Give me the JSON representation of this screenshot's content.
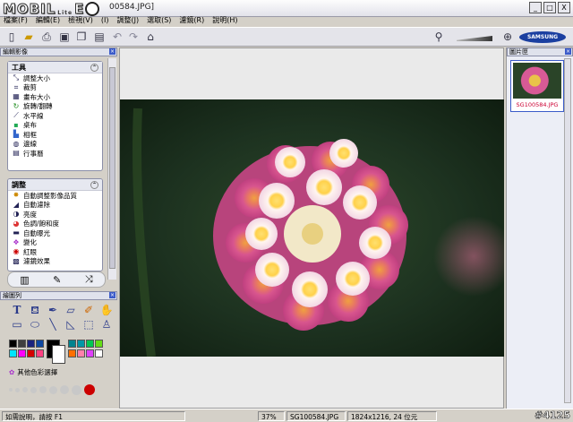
{
  "app": {
    "title_suffix": "00584.JPG]",
    "logo_left": "MOBIL",
    "logo_version": "Lite",
    "logo_right": "E"
  },
  "window_buttons": [
    "_",
    "□",
    "X"
  ],
  "menu": [
    "檔案(F)",
    "編輯(E)",
    "檢視(V)",
    "(I)",
    "調整(J)",
    "選取(S)",
    "濾鏡(R)",
    "說明(H)"
  ],
  "toolbar": {
    "icons": [
      "new-icon",
      "open-icon",
      "print-icon",
      "save-icon",
      "copy-icon",
      "paste-icon",
      "undo-icon",
      "redo-icon",
      "home-icon"
    ],
    "brand": "SAMSUNG"
  },
  "left_panel": {
    "header": "編輯影像",
    "tools_section": {
      "title": "工具",
      "items": [
        "調整大小",
        "裁剪",
        "畫布大小",
        "旋轉/翻轉",
        "水平線",
        "桌布",
        "相框",
        "邊線",
        "行事曆"
      ]
    },
    "adjust_section": {
      "title": "調整",
      "items": [
        "自動調整影像品質",
        "自動濾除",
        "亮度",
        "色調/飽和度",
        "自動曝光",
        "變化",
        "紅眼",
        "濾鏡效果"
      ]
    }
  },
  "draw_panel": {
    "header": "繪圖列",
    "more_colors": "其他色彩選擇",
    "colors": {
      "row1": [
        "#000000",
        "#3f3f3f",
        "#1a237e",
        "#0d47a1",
        "#1b5e20"
      ],
      "row1b": [
        "#00838f",
        "#0097a7",
        "#2e7d32",
        "#00c853",
        "#64dd17"
      ],
      "row2": [
        "#00e5ff",
        "#ff00ff",
        "#d50000",
        "#ff4081",
        "#7c4dff"
      ],
      "row2b": [
        "#ff6f00",
        "#ffd600",
        "#ff80ab",
        "#e040fb",
        "#ffffff"
      ],
      "primary": "#000000",
      "secondary": "#ffffff",
      "active_brush": "#cc0000"
    }
  },
  "right_panel": {
    "header": "圖片匣",
    "thumbnail_name": "SG100584.JPG"
  },
  "status": {
    "help": "如需說明，請按 F1",
    "zoom": "37%",
    "filename": "SG100584.JPG",
    "dimensions": "1824x1216, 24 位元",
    "watermark": "#4125"
  }
}
